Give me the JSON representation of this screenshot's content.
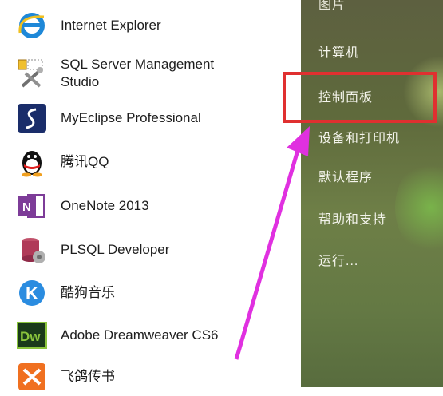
{
  "programs": [
    {
      "name": "internet-explorer",
      "label": "Internet Explorer",
      "icon": "internet-explorer-icon"
    },
    {
      "name": "sql-server",
      "label": "SQL Server Management\nStudio",
      "icon": "sql-server-tools-icon"
    },
    {
      "name": "myeclipse",
      "label": "MyEclipse Professional",
      "icon": "myeclipse-icon"
    },
    {
      "name": "qq",
      "label": "腾讯QQ",
      "icon": "qq-penguin-icon"
    },
    {
      "name": "onenote",
      "label": "OneNote 2013",
      "icon": "onenote-icon"
    },
    {
      "name": "plsql",
      "label": "PLSQL Developer",
      "icon": "plsql-database-icon"
    },
    {
      "name": "kugou",
      "label": "酷狗音乐",
      "icon": "kugou-music-icon"
    },
    {
      "name": "dreamweaver",
      "label": "Adobe Dreamweaver CS6",
      "icon": "dreamweaver-icon"
    },
    {
      "name": "feige",
      "label": "飞鸽传书",
      "icon": "feige-icon"
    }
  ],
  "right_items": {
    "partial": "图片",
    "computer": "计算机",
    "control_panel": "控制面板",
    "devices": "设备和打印机",
    "default_programs": "默认程序",
    "help": "帮助和支持",
    "run": "运行..."
  },
  "colors": {
    "highlight": "#e03030",
    "arrow": "#e030e0",
    "right_pane": "#647944"
  }
}
